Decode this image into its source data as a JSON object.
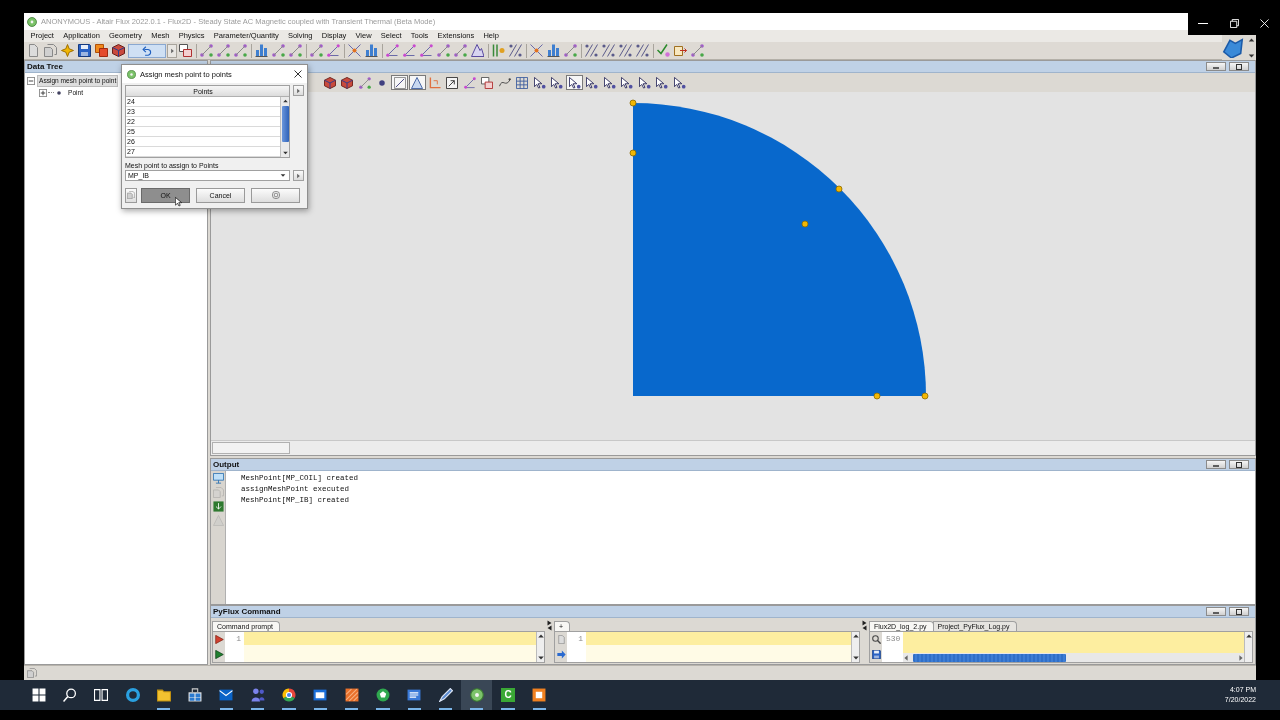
{
  "window": {
    "title": "ANONYMOUS - Altair Flux 2022.0.1 - Flux2D - Steady State AC Magnetic coupled with Transient Thermal (Beta Mode)",
    "active": false
  },
  "menu": [
    "Project",
    "Application",
    "Geometry",
    "Mesh",
    "Physics",
    "Parameter/Quantity",
    "Solving",
    "Display",
    "View",
    "Select",
    "Tools",
    "Extensions",
    "Help"
  ],
  "data_tree": {
    "title": "Data Tree",
    "items": [
      {
        "label": "Assign mesh point to point",
        "expanded": true,
        "selected": true,
        "children": [
          {
            "label": "Point",
            "expanded": false,
            "selected": false
          }
        ]
      }
    ]
  },
  "dialog": {
    "title": "Assign mesh point to points",
    "table": {
      "header": "Points",
      "rows": [
        "24",
        "23",
        "22",
        "25",
        "26",
        "27"
      ]
    },
    "field_label": "Mesh point to assign to Points",
    "field_value": "MP_IB",
    "buttons": [
      {
        "label": "OK",
        "pressed": true
      },
      {
        "label": "Cancel",
        "pressed": false
      }
    ]
  },
  "graphics_toolbar": [
    {
      "pressed": false
    },
    {
      "pressed": false
    },
    {
      "pressed": false
    },
    {
      "pressed": false
    },
    {
      "pressed": true
    },
    {
      "pressed": true
    },
    {
      "pressed": false
    },
    {
      "pressed": false
    },
    {
      "pressed": false
    },
    {
      "pressed": false
    },
    {
      "pressed": false
    },
    {
      "pressed": false
    },
    {
      "pressed": false
    },
    {
      "pressed": false
    },
    {
      "pressed": true
    },
    {
      "pressed": false
    },
    {
      "pressed": false
    },
    {
      "pressed": false
    },
    {
      "pressed": false
    },
    {
      "pressed": false
    },
    {
      "pressed": false
    }
  ],
  "output": {
    "title": "Output",
    "tools": [
      {
        "disabled": false
      },
      {
        "disabled": true
      },
      {
        "disabled": false
      },
      {
        "disabled": true
      }
    ],
    "lines": [
      "MeshPoint[MP_COIL] created",
      "assignMeshPoint executed",
      "MeshPoint[MP_IB] created"
    ]
  },
  "pyflux": {
    "title": "PyFlux Command",
    "panes": [
      {
        "kind": "prompt",
        "tabs": [
          {
            "label": "Command prompt",
            "selected": true
          }
        ],
        "line_number": "1"
      },
      {
        "kind": "editor",
        "tabs": [
          {
            "label": "+",
            "selected": true
          }
        ],
        "line_number": "1"
      },
      {
        "kind": "log",
        "tabs": [
          {
            "label": "Flux2D_log_2.py",
            "selected": true
          },
          {
            "label": "Project_PyFlux_Log.py",
            "selected": false
          }
        ],
        "line_number": "530"
      }
    ]
  },
  "taskbar": {
    "apps": [
      {
        "running": false,
        "active": false
      },
      {
        "running": true,
        "active": false
      },
      {
        "running": false,
        "active": false
      },
      {
        "running": true,
        "active": false
      },
      {
        "running": true,
        "active": false
      },
      {
        "running": true,
        "active": false
      },
      {
        "running": true,
        "active": false
      },
      {
        "running": true,
        "active": false
      },
      {
        "running": true,
        "active": false
      },
      {
        "running": true,
        "active": false
      },
      {
        "running": true,
        "active": false
      },
      {
        "running": true,
        "active": true
      },
      {
        "running": true,
        "active": false,
        "label": "C"
      },
      {
        "running": true,
        "active": false
      }
    ],
    "time": "4:07 PM",
    "date": "7/20/2022"
  }
}
